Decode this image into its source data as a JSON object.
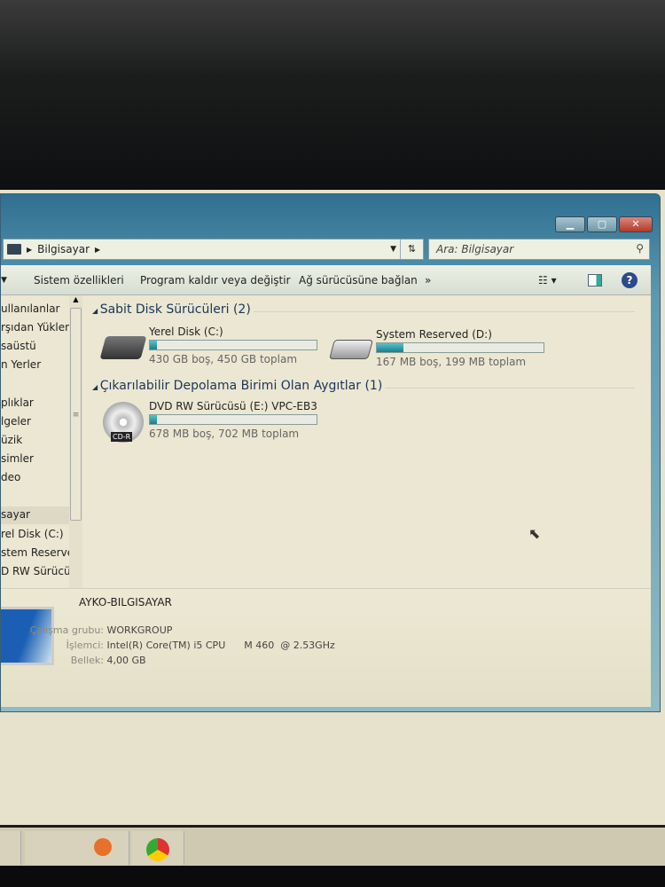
{
  "window": {
    "address": [
      "Bilgisayar"
    ],
    "search_placeholder": "Ara: Bilgisayar"
  },
  "toolbar": {
    "items": [
      "Sistem özellikleri",
      "Program kaldır veya değiştir",
      "Ağ sürücüsüne bağlan"
    ],
    "more": "»"
  },
  "nav": {
    "items": [
      "ullanılanlar",
      "rşıdan Yüklem",
      "saüstü",
      "n Yerler",
      "plıklar",
      "lgeler",
      "üzik",
      "simler",
      "deo",
      "sayar",
      "rel Disk (C:)",
      "stem Reserved",
      "D RW Sürücüs"
    ],
    "selected": "sayar"
  },
  "groups": [
    {
      "title": "Sabit Disk Sürücüleri (2)",
      "drives": [
        {
          "name": "Yerel Disk (C:)",
          "size": "430 GB boş, 450 GB toplam",
          "used_fraction": 0.044
        },
        {
          "name": "System Reserved (D:)",
          "size": "167 MB boş, 199 MB toplam",
          "used_fraction": 0.16
        }
      ]
    },
    {
      "title": "Çıkarılabilir Depolama Birimi Olan Aygıtlar (1)",
      "drives": [
        {
          "name": "DVD RW Sürücüsü (E:) VPC-EB3",
          "size": "678 MB boş, 702 MB toplam",
          "used_fraction": 0.034,
          "badge": "CD-R"
        }
      ]
    }
  ],
  "details": {
    "computer_name": "AYKO-BILGISAYAR",
    "rows": [
      {
        "k": "Çalışma grubu:",
        "v": "WORKGROUP"
      },
      {
        "k": "İşlemci:",
        "v": "Intel(R) Core(TM) i5 CPU      M 460  @ 2.53GHz"
      },
      {
        "k": "Bellek:",
        "v": "4,00 GB"
      }
    ]
  },
  "colors": {
    "accent": "#2f6f91",
    "bar": "#1e7c8c"
  }
}
